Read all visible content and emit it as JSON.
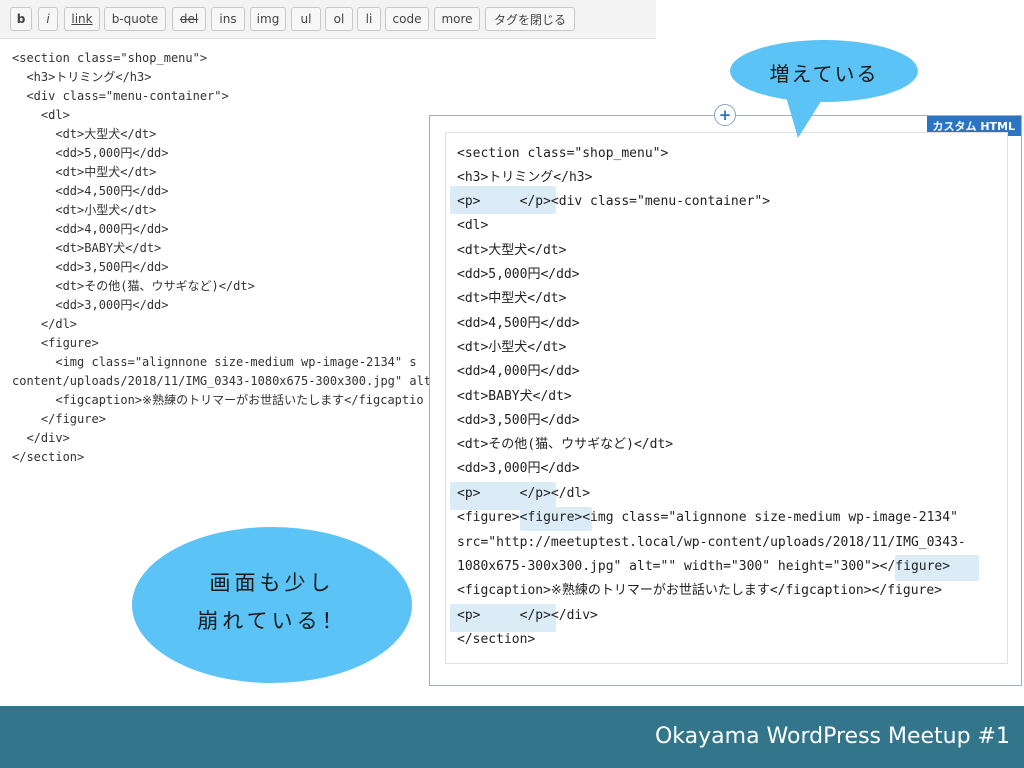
{
  "toolbar": {
    "buttons": [
      "b",
      "i",
      "link",
      "b-quote",
      "del",
      "ins",
      "img",
      "ul",
      "ol",
      "li",
      "code",
      "more",
      "タグを閉じる"
    ]
  },
  "editor_code": [
    "<section class=\"shop_menu\">",
    "  <h3>トリミング</h3>",
    "  <div class=\"menu-container\">",
    "    <dl>",
    "      <dt>大型犬</dt>",
    "      <dd>5,000円</dd>",
    "      <dt>中型犬</dt>",
    "      <dd>4,500円</dd>",
    "      <dt>小型犬</dt>",
    "      <dd>4,000円</dd>",
    "      <dt>BABY犬</dt>",
    "      <dd>3,500円</dd>",
    "      <dt>その他(猫、ウサギなど)</dt>",
    "      <dd>3,000円</dd>",
    "    </dl>",
    "    <figure>",
    "      <img class=\"alignnone size-medium wp-image-2134\" s",
    "content/uploads/2018/11/IMG_0343-1080x675-300x300.jpg\" alt",
    "      <figcaption>※熟練のトリマーがお世話いたします</figcaptio",
    "    </figure>",
    "  </div>",
    "</section>"
  ],
  "panel": {
    "label": "カスタム HTML",
    "plus_icon": "+"
  },
  "preview_code": {
    "l01": "<section class=\"shop_menu\">",
    "l02": "<h3>トリミング</h3>",
    "l03": "<p>     </p><div class=\"menu-container\">",
    "l04": "<dl>",
    "l05": "<dt>大型犬</dt>",
    "l06": "<dd>5,000円</dd>",
    "l07": "<dt>中型犬</dt>",
    "l08": "<dd>4,500円</dd>",
    "l09": "<dt>小型犬</dt>",
    "l10": "<dd>4,000円</dd>",
    "l11": "<dt>BABY犬</dt>",
    "l12": "<dd>3,500円</dd>",
    "l13": "<dt>その他(猫、ウサギなど)</dt>",
    "l14": "<dd>3,000円</dd>",
    "l15": "<p>     </p></dl>",
    "l16": "<figure><figure><img class=\"alignnone size-medium wp-image-2134\"",
    "l17": "src=\"http://meetuptest.local/wp-content/uploads/2018/11/IMG_0343-",
    "l18": "1080x675-300x300.jpg\" alt=\"\" width=\"300\" height=\"300\"></figure>",
    "l19": "<figcaption>※熟練のトリマーがお世話いたします</figcaption></figure>",
    "l20": "<p>     </p></div>",
    "l21": "</section>"
  },
  "callouts": {
    "top": "増えている",
    "left_line1": "画面も少し",
    "left_line2": "崩れている！"
  },
  "footer": {
    "text": "Okayama WordPress Meetup #1"
  },
  "colors": {
    "bubble": "#5bc3f5",
    "footer": "#33768c",
    "highlight": "#dcecf7",
    "panel_label": "#2a75c3"
  }
}
